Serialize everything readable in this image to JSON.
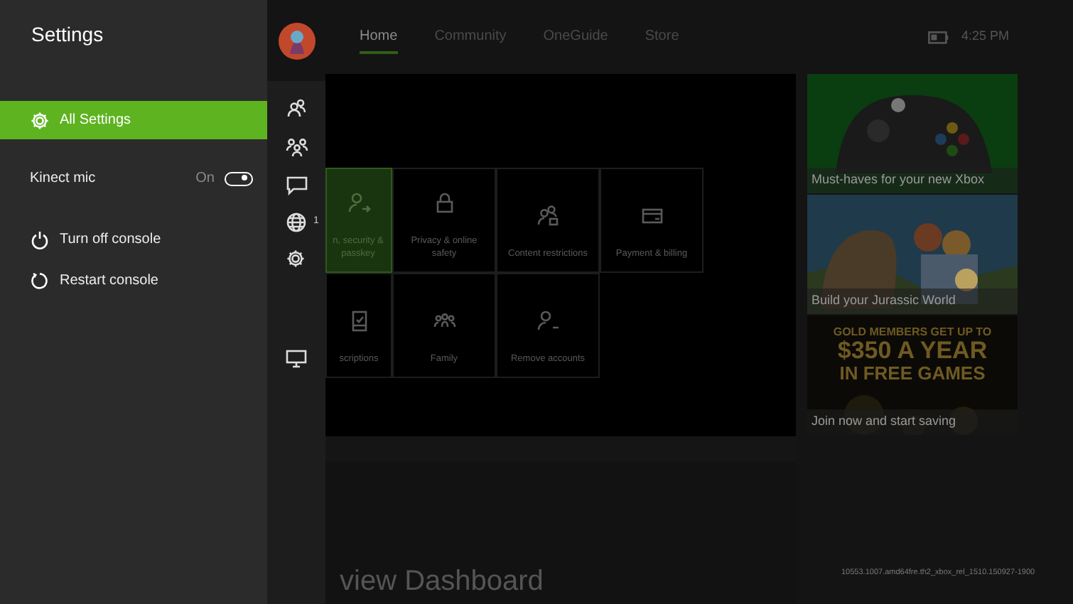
{
  "settings_panel": {
    "title": "Settings",
    "items": [
      {
        "kind": "link",
        "label": "All Settings",
        "selected": true
      },
      {
        "kind": "toggle",
        "label": "Kinect mic",
        "state_label": "On",
        "on": true
      },
      {
        "kind": "link",
        "label": "Turn off console",
        "selected": false
      },
      {
        "kind": "link",
        "label": "Restart console",
        "selected": false
      }
    ]
  },
  "rail": {
    "badge": "1"
  },
  "nav": {
    "tabs": [
      {
        "label": "Home",
        "selected": true
      },
      {
        "label": "Community",
        "selected": false
      },
      {
        "label": "OneGuide",
        "selected": false
      },
      {
        "label": "Store",
        "selected": false
      }
    ],
    "clock": "4:25 PM"
  },
  "tiles": [
    {
      "label": "n, security & passkey",
      "selected": true
    },
    {
      "label": "Privacy & online safety",
      "selected": false
    },
    {
      "label": "Content restrictions",
      "selected": false
    },
    {
      "label": "Payment & billing",
      "selected": false
    },
    {
      "label": "scriptions",
      "selected": false
    },
    {
      "label": "Family",
      "selected": false
    },
    {
      "label": "Remove accounts",
      "selected": false
    }
  ],
  "promos": [
    {
      "caption": "Must-haves for your new Xbox"
    },
    {
      "caption": "Build your Jurassic World"
    },
    {
      "headline": [
        "GOLD MEMBERS GET UP TO",
        "$350 A YEAR",
        "IN FREE GAMES"
      ],
      "caption": "Join now and start saving"
    }
  ],
  "bottom_heading": "view Dashboard",
  "build": "10553.1007.amd64fre.th2_xbox_rel_1510.150927-1900"
}
